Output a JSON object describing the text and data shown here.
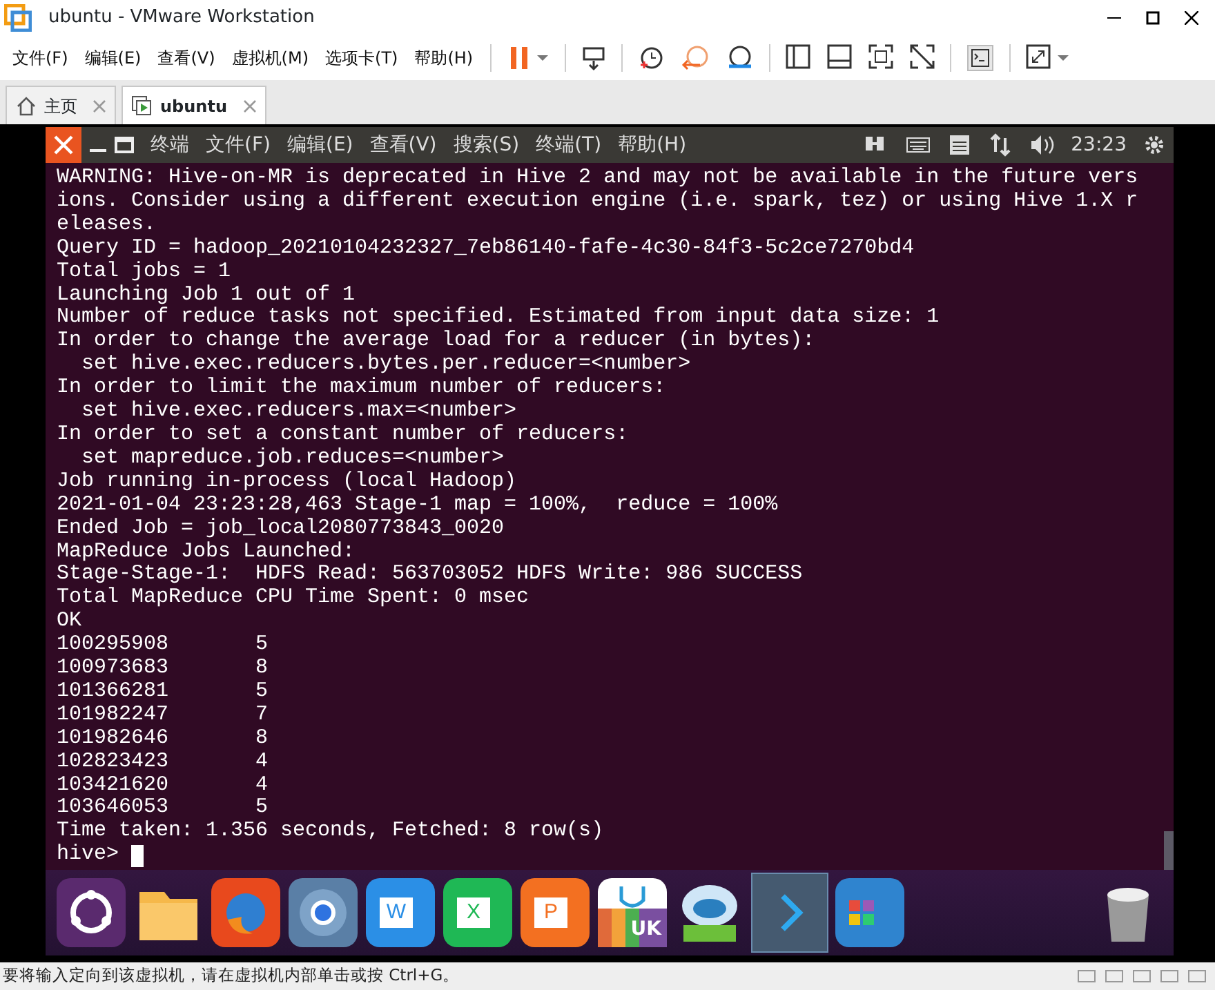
{
  "window": {
    "title": "ubuntu - VMware Workstation"
  },
  "menu": [
    "文件(F)",
    "编辑(E)",
    "查看(V)",
    "虚拟机(M)",
    "选项卡(T)",
    "帮助(H)"
  ],
  "tabs": [
    {
      "label": "主页",
      "selected": false,
      "kind": "home"
    },
    {
      "label": "ubuntu",
      "selected": true,
      "kind": "vm"
    }
  ],
  "guest_panel": {
    "menus": [
      "终端",
      "文件(F)",
      "编辑(E)",
      "查看(V)",
      "搜索(S)",
      "终端(T)",
      "帮助(H)"
    ],
    "clock": "23:23"
  },
  "terminal": {
    "lines": [
      "WARNING: Hive-on-MR is deprecated in Hive 2 and may not be available in the future vers",
      "ions. Consider using a different execution engine (i.e. spark, tez) or using Hive 1.X r",
      "eleases.",
      "Query ID = hadoop_20210104232327_7eb86140-fafe-4c30-84f3-5c2ce7270bd4",
      "Total jobs = 1",
      "Launching Job 1 out of 1",
      "Number of reduce tasks not specified. Estimated from input data size: 1",
      "In order to change the average load for a reducer (in bytes):",
      "  set hive.exec.reducers.bytes.per.reducer=<number>",
      "In order to limit the maximum number of reducers:",
      "  set hive.exec.reducers.max=<number>",
      "In order to set a constant number of reducers:",
      "  set mapreduce.job.reduces=<number>",
      "Job running in-process (local Hadoop)",
      "2021-01-04 23:23:28,463 Stage-1 map = 100%,  reduce = 100%",
      "Ended Job = job_local2080773843_0020",
      "MapReduce Jobs Launched:",
      "Stage-Stage-1:  HDFS Read: 563703052 HDFS Write: 986 SUCCESS",
      "Total MapReduce CPU Time Spent: 0 msec",
      "OK",
      "100295908       5",
      "100973683       8",
      "101366281       5",
      "101982247       7",
      "101982646       8",
      "102823423       4",
      "103421620       4",
      "103646053       5",
      "Time taken: 1.356 seconds, Fetched: 8 row(s)"
    ],
    "prompt": "hive>"
  },
  "dock": [
    {
      "kind": "ubuntu",
      "selected": false
    },
    {
      "kind": "folder",
      "selected": false
    },
    {
      "kind": "firefox",
      "selected": false
    },
    {
      "kind": "chrome",
      "selected": false
    },
    {
      "kind": "word",
      "selected": false,
      "label": "W"
    },
    {
      "kind": "excel",
      "selected": false,
      "label": "X"
    },
    {
      "kind": "ppt",
      "selected": false,
      "label": "P"
    },
    {
      "kind": "store",
      "selected": false,
      "label": "UK"
    },
    {
      "kind": "robot",
      "selected": false
    },
    {
      "kind": "terminal",
      "selected": true
    },
    {
      "kind": "apps",
      "selected": false
    },
    {
      "kind": "trash",
      "selected": false
    }
  ],
  "status_bar": {
    "text": "要将输入定向到该虚拟机，请在虚拟机内部单击或按 Ctrl+G。"
  }
}
